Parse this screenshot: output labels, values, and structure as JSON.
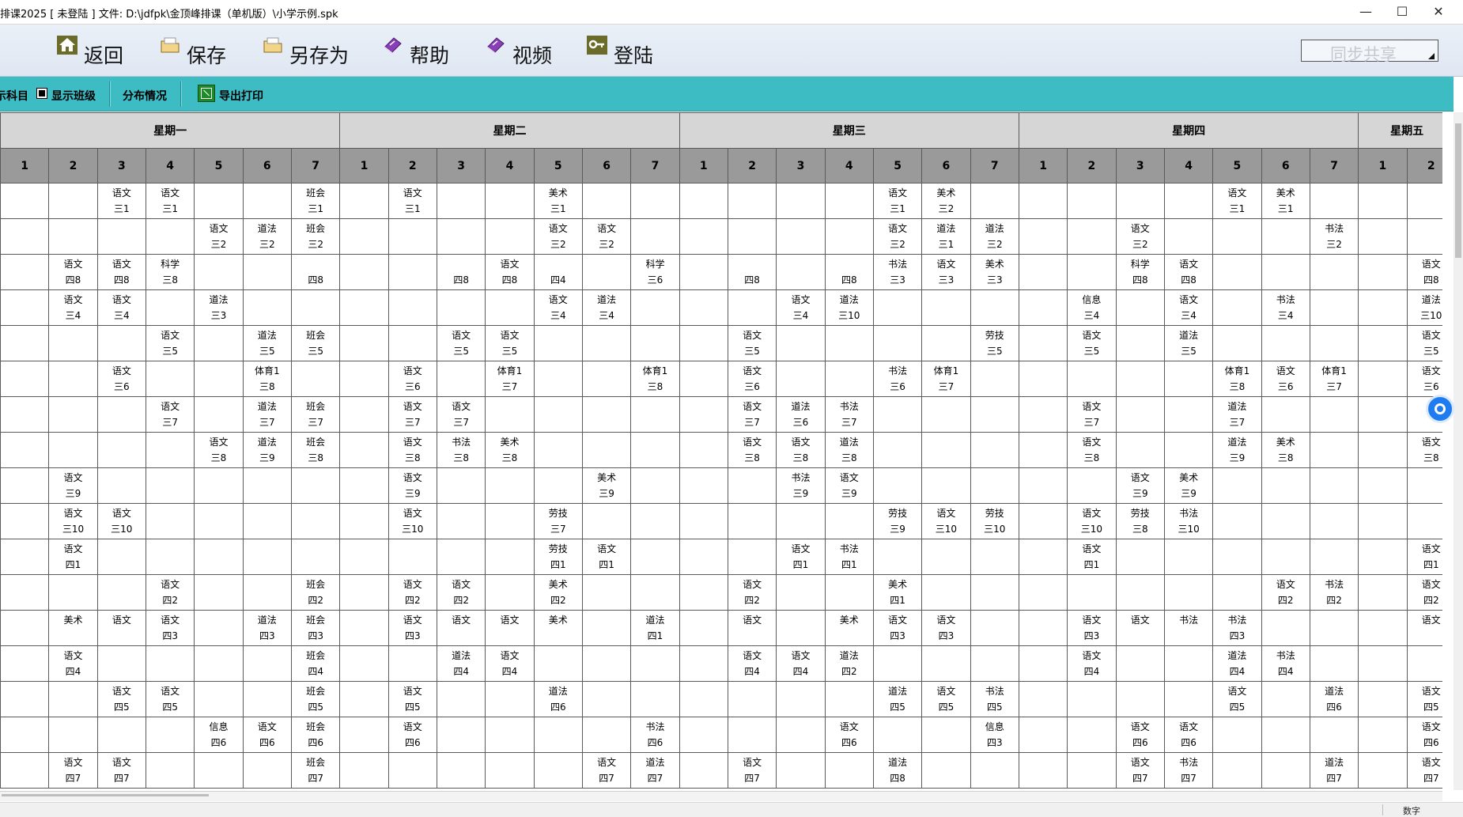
{
  "window": {
    "title": "排课2025 [ 未登陆 ] 文件: D:\\jdfpk\\金顶峰排课（单机版）\\小学示例.spk",
    "minimize": "—",
    "maximize": "☐",
    "close": "✕"
  },
  "toolbar": {
    "buttons": [
      {
        "label": "返回",
        "icon": "home-icon"
      },
      {
        "label": "保存",
        "icon": "folder-icon"
      },
      {
        "label": "另存为",
        "icon": "folder-icon"
      },
      {
        "label": "帮助",
        "icon": "book-icon"
      },
      {
        "label": "视频",
        "icon": "book-icon"
      },
      {
        "label": "登陆",
        "icon": "key-icon"
      }
    ],
    "sync_label": "同步共享"
  },
  "subbar": {
    "subject_label": "示科目",
    "show_class_label": "显示班级",
    "show_class_checked": true,
    "distribution_label": "分布情况",
    "export_label": "导出打印"
  },
  "days": [
    "星期一",
    "星期二",
    "星期三",
    "星期四",
    "星期五"
  ],
  "periods": [
    "1",
    "2",
    "3",
    "4",
    "5",
    "6",
    "7"
  ],
  "friday_visible_periods": [
    "1",
    "2"
  ],
  "rows": [
    [
      "",
      "",
      "语文|三1",
      "语文|三1",
      "",
      "",
      "班会|三1",
      "",
      "语文|三1",
      "",
      "",
      "美术|三1",
      "",
      "",
      "",
      "",
      "",
      "",
      "语文|三1",
      "美术|三2",
      "",
      "",
      "",
      "",
      "",
      "语文|三1",
      "美术|三1",
      "",
      "",
      ""
    ],
    [
      "",
      "",
      "",
      "",
      "语文|三2",
      "道法|三2",
      "班会|三2",
      "",
      "",
      "",
      "",
      "语文|三2",
      "语文|三2",
      "",
      "",
      "",
      "",
      "",
      "语文|三2",
      "道法|三1",
      "道法|三2",
      "",
      "",
      "语文|三2",
      "",
      "",
      "",
      "书法|三2",
      "",
      ""
    ],
    [
      "",
      "语文|四8",
      "语文|四8",
      "科学|三8",
      "",
      "",
      "四8",
      "",
      "",
      "四8",
      "语文|四8",
      "四4",
      "",
      "科学|三6",
      "",
      "四8",
      "",
      "四8",
      "书法|三3",
      "语文|三3",
      "美术|三3",
      "",
      "",
      "科学|四8",
      "语文|四8",
      "",
      "",
      "",
      "",
      "语文|四8"
    ],
    [
      "",
      "语文|三4",
      "语文|三4",
      "",
      "道法|三3",
      "",
      "",
      "",
      "",
      "",
      "",
      "语文|三4",
      "道法|三4",
      "",
      "",
      "",
      "语文|三4",
      "道法|三10",
      "",
      "",
      "",
      "",
      "信息|三4",
      "",
      "语文|三4",
      "",
      "书法|三4",
      "",
      "",
      "道法|三10"
    ],
    [
      "",
      "",
      "",
      "语文|三5",
      "",
      "道法|三5",
      "班会|三5",
      "",
      "",
      "语文|三5",
      "语文|三5",
      "",
      "",
      "",
      "",
      "语文|三5",
      "",
      "",
      "",
      "",
      "劳技|三5",
      "",
      "语文|三5",
      "",
      "道法|三5",
      "",
      "",
      "",
      "",
      "语文|三5"
    ],
    [
      "",
      "",
      "语文|三6",
      "",
      "",
      "体育1|三8",
      "",
      "",
      "语文|三6",
      "",
      "体育1|三7",
      "",
      "",
      "体育1|三8",
      "",
      "语文|三6",
      "",
      "",
      "书法|三6",
      "体育1|三7",
      "",
      "",
      "",
      "",
      "",
      "体育1|三8",
      "语文|三6",
      "体育1|三7",
      "",
      "语文|三6"
    ],
    [
      "",
      "",
      "",
      "语文|三7",
      "",
      "道法|三7",
      "班会|三7",
      "",
      "语文|三7",
      "语文|三7",
      "",
      "",
      "",
      "",
      "",
      "语文|三7",
      "道法|三6",
      "书法|三7",
      "",
      "",
      "",
      "",
      "语文|三7",
      "",
      "",
      "道法|三7",
      "",
      "",
      "",
      ""
    ],
    [
      "",
      "",
      "",
      "",
      "语文|三8",
      "道法|三9",
      "班会|三8",
      "",
      "语文|三8",
      "书法|三8",
      "美术|三8",
      "",
      "",
      "",
      "",
      "语文|三8",
      "语文|三8",
      "道法|三8",
      "",
      "",
      "",
      "",
      "语文|三8",
      "",
      "",
      "道法|三9",
      "美术|三8",
      "",
      "",
      "语文|三8"
    ],
    [
      "",
      "语文|三9",
      "",
      "",
      "",
      "",
      "",
      "",
      "语文|三9",
      "",
      "",
      "",
      "美术|三9",
      "",
      "",
      "",
      "书法|三9",
      "语文|三9",
      "",
      "",
      "",
      "",
      "",
      "语文|三9",
      "美术|三9",
      "",
      "",
      "",
      "",
      ""
    ],
    [
      "",
      "语文|三10",
      "语文|三10",
      "",
      "",
      "",
      "",
      "",
      "语文|三10",
      "",
      "",
      "劳技|三7",
      "",
      "",
      "",
      "",
      "",
      "",
      "劳技|三9",
      "语文|三10",
      "劳技|三10",
      "",
      "语文|三10",
      "劳技|三8",
      "书法|三10",
      "",
      "",
      "",
      "",
      ""
    ],
    [
      "",
      "语文|四1",
      "",
      "",
      "",
      "",
      "",
      "",
      "",
      "",
      "",
      "劳技|四1",
      "语文|四1",
      "",
      "",
      "",
      "语文|四1",
      "书法|四1",
      "",
      "",
      "",
      "",
      "语文|四1",
      "",
      "",
      "",
      "",
      "",
      "",
      "语文|四1"
    ],
    [
      "",
      "",
      "",
      "语文|四2",
      "",
      "",
      "班会|四2",
      "",
      "语文|四2",
      "语文|四2",
      "",
      "美术|四2",
      "",
      "",
      "",
      "语文|四2",
      "",
      "",
      "美术|四1",
      "",
      "",
      "",
      "",
      "",
      "",
      "",
      "语文|四2",
      "书法|四2",
      "",
      "语文|四2"
    ],
    [
      "",
      "美术|",
      "语文|",
      "语文|四3",
      "",
      "道法|四3",
      "班会|四3",
      "",
      "语文|四3",
      "语文|",
      "语文|",
      "美术|",
      "",
      "道法|四1",
      "",
      "语文|",
      "",
      "美术|",
      "语文|四3",
      "语文|四3",
      "",
      "",
      "语文|四3",
      "语文|",
      "书法|",
      "书法|四3",
      "",
      "",
      "",
      "语文|"
    ],
    [
      "",
      "语文|四4",
      "",
      "",
      "",
      "",
      "班会|四4",
      "",
      "",
      "道法|四4",
      "语文|四4",
      "",
      "",
      "",
      "",
      "语文|四4",
      "语文|四4",
      "道法|四2",
      "",
      "",
      "",
      "",
      "语文|四4",
      "",
      "",
      "道法|四4",
      "书法|四4",
      "",
      "",
      ""
    ],
    [
      "",
      "",
      "语文|四5",
      "语文|四5",
      "",
      "",
      "班会|四5",
      "",
      "语文|四5",
      "",
      "",
      "道法|四6",
      "",
      "",
      "",
      "",
      "",
      "",
      "道法|四5",
      "语文|四5",
      "书法|四5",
      "",
      "",
      "",
      "",
      "语文|四5",
      "",
      "道法|四6",
      "",
      "语文|四5"
    ],
    [
      "",
      "",
      "",
      "",
      "信息|四6",
      "语文|四6",
      "班会|四6",
      "",
      "语文|四6",
      "",
      "",
      "",
      "",
      "书法|四6",
      "",
      "",
      "",
      "语文|四6",
      "",
      "",
      "信息|四3",
      "",
      "",
      "语文|四6",
      "语文|四6",
      "",
      "",
      "",
      "",
      "语文|四6"
    ],
    [
      "",
      "语文|四7",
      "语文|四7",
      "",
      "",
      "",
      "班会|四7",
      "",
      "",
      "",
      "",
      "",
      "语文|四7",
      "道法|四7",
      "",
      "语文|四7",
      "",
      "",
      "道法|四8",
      "",
      "",
      "",
      "",
      "语文|四7",
      "书法|四7",
      "",
      "",
      "道法|四7",
      "",
      "语文|四7"
    ]
  ],
  "status": {
    "mode": "数字"
  }
}
